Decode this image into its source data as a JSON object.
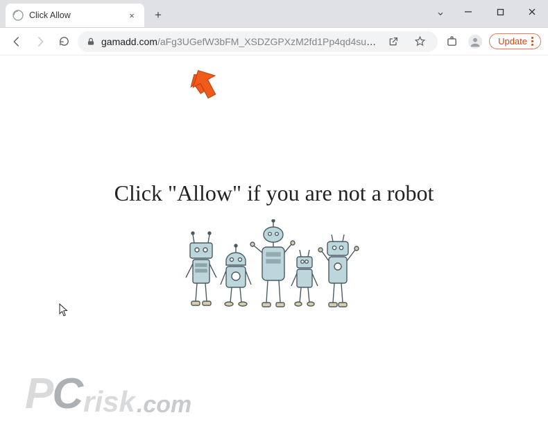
{
  "titlebar": {
    "tab_title": "Click Allow",
    "close_glyph": "×",
    "newtab_glyph": "+",
    "caret_glyph": "⌄",
    "minimize_glyph": "—",
    "maximize_glyph": "□",
    "closewin_glyph": "×"
  },
  "toolbar": {
    "back_glyph": "←",
    "forward_glyph": "→",
    "reload_glyph": "⟳",
    "lock_glyph": "🔒",
    "share_glyph": "↗",
    "star_glyph": "☆",
    "ext_glyph": "▣",
    "profile_glyph": "👤",
    "update_label": "Update"
  },
  "address": {
    "host": "gamadd.com",
    "path": "/aFg3UGefW3bFM_XSDZGPXzM2fd1Pp4qd4su6ay…"
  },
  "page": {
    "headline": "Click \"Allow\"   if you are not   a robot"
  },
  "watermark": {
    "p": "P",
    "c": "C",
    "risk": "risk",
    "com": ".com"
  }
}
